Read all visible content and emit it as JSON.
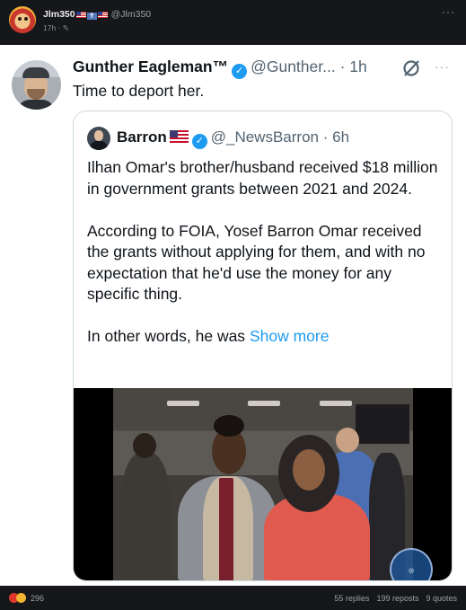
{
  "post": {
    "username": "Jlm350",
    "handle": "@Jlm350",
    "time": "17h",
    "menu_icon": "more-icon"
  },
  "tweet": {
    "name": "Gunther Eagleman™",
    "handle": "@Gunther...",
    "separator": "·",
    "time": "1h",
    "text": "Time to deport her.",
    "quote": {
      "name": "Barron",
      "handle": "@_NewsBarron",
      "separator": "·",
      "time": "6h",
      "paragraphs": [
        "Ilhan Omar's brother/husband received $18 million in government grants between 2021 and 2024.",
        "According to FOIA, Yosef Barron Omar received the grants without applying for them, and with no expectation that he'd use the money for any specific thing."
      ],
      "last_line": "In other words, he was",
      "show_more": "Show more"
    }
  },
  "footer": {
    "reaction_count": "296",
    "replies": "55 replies",
    "reposts": "199 reposts",
    "quotes": "9 quotes"
  },
  "colors": {
    "accent": "#1d9bf0",
    "background": "#16171a",
    "card": "#ffffff"
  }
}
